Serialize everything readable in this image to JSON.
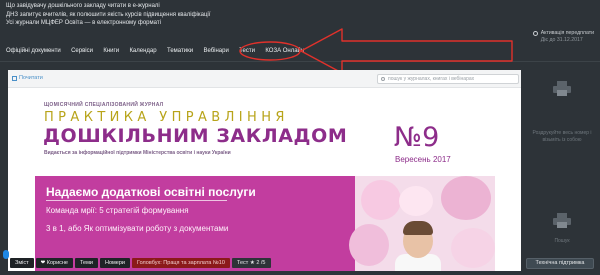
{
  "top_links": [
    "Що завідувачу дошкільного закладу читати в е-журналі",
    "ДНЗ запитує вчителів, як полюшити якість курсів підвищення кваліфікації",
    "Усі журнали МЦФЕР Освіта — в електронному форматі"
  ],
  "account": {
    "activation_label": "Активація передплати",
    "subscription_until": "Діє до 31.12.2017"
  },
  "nav": [
    "Офіційні документи",
    "Сервіси",
    "Книги",
    "Календар",
    "Тематики",
    "Вебінари",
    "Тести",
    "КОЗА Онлайн"
  ],
  "viewer": {
    "back_label": "Почитати",
    "search_placeholder": "пошук у журналах, книгах і вебінарах"
  },
  "magazine": {
    "subtitle": "ЩОМІСЯЧНИЙ СПЕЦІАЛІЗОВАНИЙ ЖУРНАЛ",
    "title_line1": "ПРАКТИКА УПРАВЛІННЯ",
    "title_line2": "ДОШКІЛЬНИМ ЗАКЛАДОМ",
    "support": "Видається за інформаційної підтримки Міністерства освіти і науки України",
    "issue_number": "№9",
    "issue_date": "Вересень 2017"
  },
  "banner": {
    "headline": "Надаємо додаткові освітні послуги",
    "items": [
      "Команда мрії: 5 стратегій формування",
      "3 в 1, або Як оптимізувати роботу з документами"
    ]
  },
  "side_panel": {
    "print_text": "Роздрукуйте весь номер і візьміть із собою",
    "print_label": "Пошук"
  },
  "bottom_bar": {
    "contents": "Зміст",
    "favorites": "Корисне",
    "topics": "Теми",
    "issues": "Номери",
    "current": "Головбух: Праця та зарплата №10",
    "test": "Тест",
    "test_score": "2 /5"
  },
  "support_button": "Технічна підтримка",
  "colors": {
    "background": "#2d3338",
    "magazine_purple": "#8d2d8a",
    "banner_magenta": "#c23d9f",
    "annotation_red": "#e0312b",
    "current_issue_red": "#8b1a1a"
  }
}
